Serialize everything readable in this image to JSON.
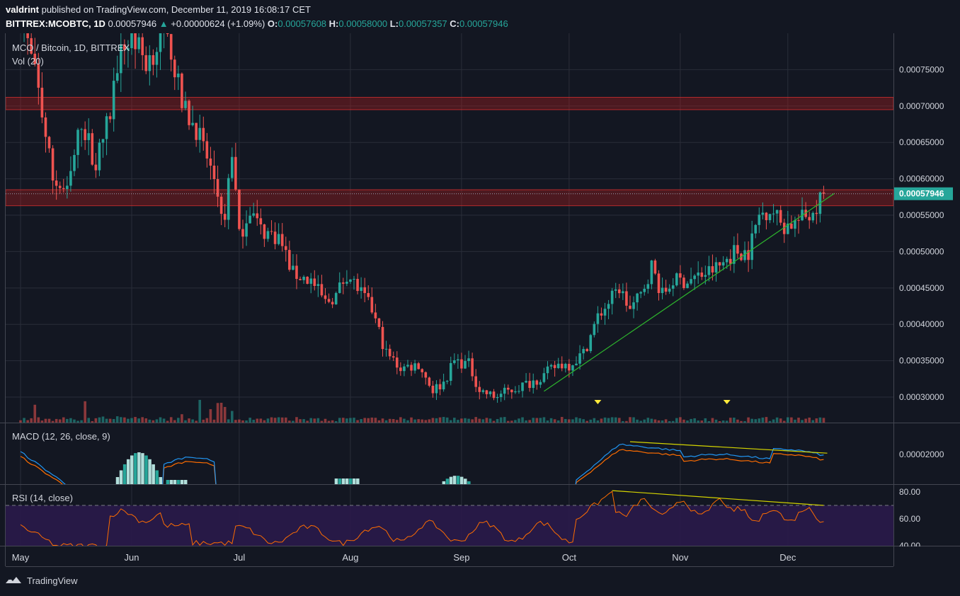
{
  "header": {
    "publisher": "valdrint",
    "published_text": "published on TradingView.com, December 11, 2019 16:08:17 CET",
    "symbol": "BITTREX:MCOBTC, 1D",
    "last": "0.00057946",
    "change": "+0.00000624 (+1.09%)",
    "open_label": "O:",
    "open": "0.00057608",
    "high_label": "H:",
    "high": "0.00058000",
    "low_label": "L:",
    "low": "0.00057357",
    "close_label": "C:",
    "close": "0.00057946"
  },
  "panes": {
    "main_legend": "MCO / Bitcoin, 1D, BITTREX",
    "volume_legend": "Vol (20)",
    "macd_legend": "MACD (12, 26, close, 9)",
    "rsi_legend": "RSI (14, close)"
  },
  "footer": {
    "brand": "TradingView"
  },
  "colors": {
    "background": "#131722",
    "up": "#26a69a",
    "down": "#ef5350",
    "grid": "#2a2e39",
    "resistance_zone": "#b71c1c",
    "trendline": "#2db52d",
    "divergence": "#d4d400",
    "macd_line": "#2196f3",
    "signal_line": "#ff6d00",
    "rsi_line": "#ff6d00",
    "rsi_band": "#2a1a4a",
    "marker": "#ffeb3b"
  },
  "chart_data": {
    "type": "candlestick",
    "x_labels": [
      "May",
      "Jun",
      "Jul",
      "Aug",
      "Sep",
      "Oct",
      "Nov",
      "Dec"
    ],
    "price_axis": {
      "ticks": [
        0.0003,
        0.00035,
        0.0004,
        0.00045,
        0.0005,
        0.00055,
        0.0006,
        0.00065,
        0.0007,
        0.00075
      ],
      "tick_labels": [
        "0.00030000",
        "0.00035000",
        "0.00040000",
        "0.00045000",
        "0.00050000",
        "0.00055000",
        "0.00060000",
        "0.00065000",
        "0.00070000",
        "0.00075000"
      ],
      "range": [
        0.000265,
        0.0008
      ],
      "last_price_label": "0.00057946",
      "last_price": 0.00057946
    },
    "resistance_zones": [
      [
        0.000695,
        0.000712
      ],
      [
        0.000563,
        0.000585
      ]
    ],
    "trendline": {
      "start": [
        "2019-09-24",
        0.000308
      ],
      "end": [
        "2019-12-14",
        0.00058
      ]
    },
    "price_anchors": [
      [
        "2019-05-01",
        0.00083
      ],
      [
        "2019-05-06",
        0.00072
      ],
      [
        "2019-05-10",
        0.0006
      ],
      [
        "2019-05-14",
        0.00058
      ],
      [
        "2019-05-18",
        0.00068
      ],
      [
        "2019-05-22",
        0.00062
      ],
      [
        "2019-05-26",
        0.00069
      ],
      [
        "2019-05-28",
        0.00076
      ],
      [
        "2019-06-01",
        0.0008
      ],
      [
        "2019-06-05",
        0.00076
      ],
      [
        "2019-06-09",
        0.00079
      ],
      [
        "2019-06-12",
        0.00078
      ],
      [
        "2019-06-15",
        0.0007
      ],
      [
        "2019-06-19",
        0.00067
      ],
      [
        "2019-06-24",
        0.0006
      ],
      [
        "2019-06-27",
        0.00054
      ],
      [
        "2019-06-29",
        0.00064
      ],
      [
        "2019-07-01",
        0.00052
      ],
      [
        "2019-07-04",
        0.00056
      ],
      [
        "2019-07-07",
        0.00053
      ],
      [
        "2019-07-12",
        0.00052
      ],
      [
        "2019-07-16",
        0.00047
      ],
      [
        "2019-07-21",
        0.00046
      ],
      [
        "2019-07-25",
        0.00043
      ],
      [
        "2019-07-28",
        0.00044
      ],
      [
        "2019-07-31",
        0.00047
      ],
      [
        "2019-08-03",
        0.00045
      ],
      [
        "2019-08-07",
        0.00042
      ],
      [
        "2019-08-11",
        0.00036
      ],
      [
        "2019-08-15",
        0.00034
      ],
      [
        "2019-08-20",
        0.000345
      ],
      [
        "2019-08-24",
        0.00031
      ],
      [
        "2019-08-27",
        0.00032
      ],
      [
        "2019-08-30",
        0.00035
      ],
      [
        "2019-09-03",
        0.000345
      ],
      [
        "2019-09-06",
        0.00031
      ],
      [
        "2019-09-10",
        0.0003
      ],
      [
        "2019-09-15",
        0.00031
      ],
      [
        "2019-09-20",
        0.00032
      ],
      [
        "2019-09-24",
        0.00033
      ],
      [
        "2019-09-28",
        0.000345
      ],
      [
        "2019-10-01",
        0.000345
      ],
      [
        "2019-10-05",
        0.00036
      ],
      [
        "2019-10-09",
        0.00041
      ],
      [
        "2019-10-12",
        0.00043
      ],
      [
        "2019-10-15",
        0.00045
      ],
      [
        "2019-10-18",
        0.00042
      ],
      [
        "2019-10-21",
        0.00044
      ],
      [
        "2019-10-24",
        0.00048
      ],
      [
        "2019-10-27",
        0.00044
      ],
      [
        "2019-10-30",
        0.00046
      ],
      [
        "2019-11-03",
        0.00046
      ],
      [
        "2019-11-08",
        0.00047
      ],
      [
        "2019-11-12",
        0.00048
      ],
      [
        "2019-11-16",
        0.0005
      ],
      [
        "2019-11-20",
        0.0005
      ],
      [
        "2019-11-23",
        0.00055
      ],
      [
        "2019-11-26",
        0.00056
      ],
      [
        "2019-11-30",
        0.000535
      ],
      [
        "2019-12-03",
        0.00054
      ],
      [
        "2019-12-07",
        0.00055
      ],
      [
        "2019-12-11",
        0.000579
      ]
    ],
    "markers": [
      "2019-10-09",
      "2019-11-14"
    ],
    "macd": {
      "axis_tick": 2e-05,
      "axis_tick_label": "0.00002000",
      "divergence": {
        "start": [
          "2019-10-18",
          3e-05
        ],
        "end": [
          "2019-12-12",
          2.1e-05
        ]
      }
    },
    "rsi": {
      "ticks": [
        40,
        60,
        80
      ],
      "tick_labels": [
        "40.00",
        "60.00",
        "80.00"
      ],
      "band": [
        30,
        70
      ],
      "divergence": {
        "start": [
          "2019-10-13",
          81
        ],
        "end": [
          "2019-12-11",
          70
        ]
      }
    }
  }
}
